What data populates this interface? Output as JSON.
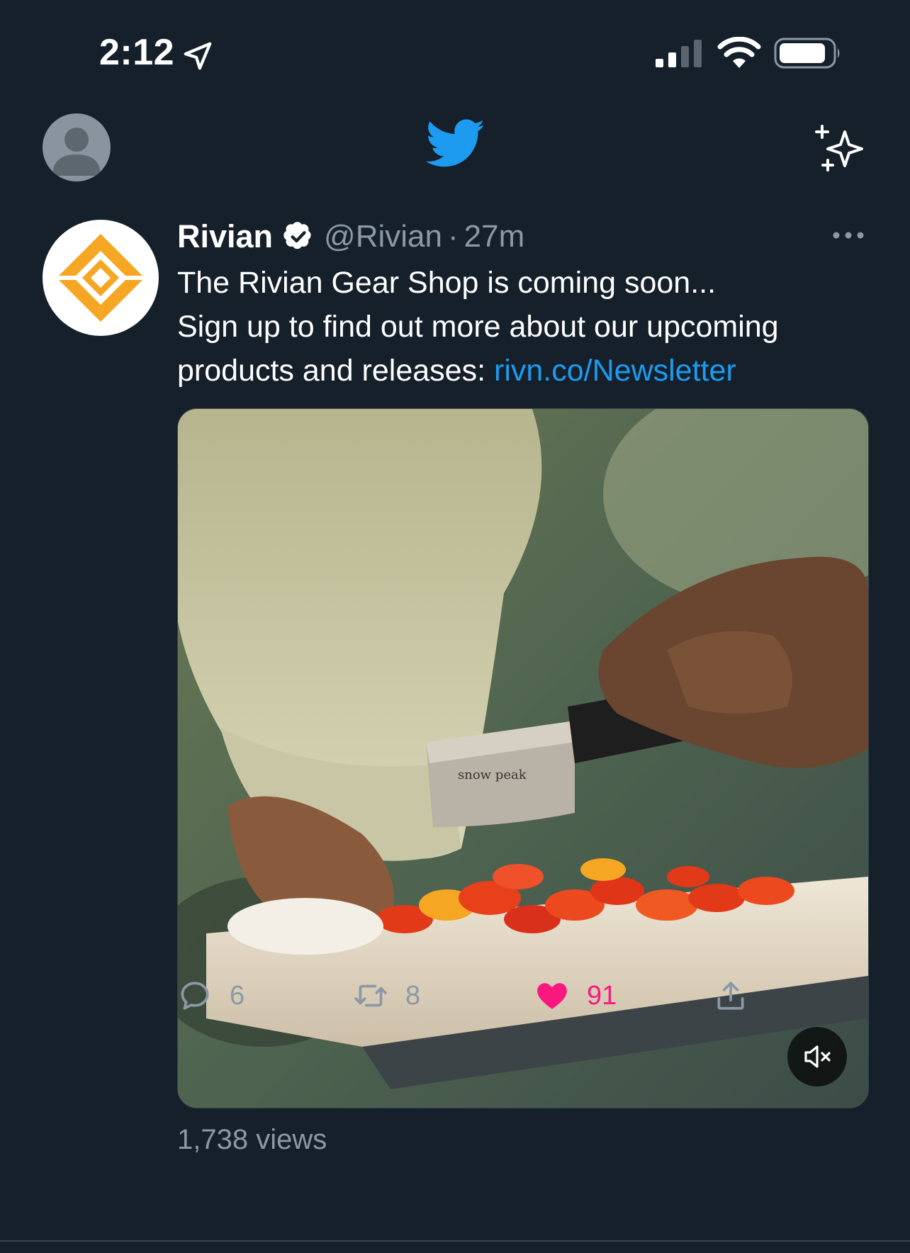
{
  "status_bar": {
    "time": "2:12",
    "icons": [
      "location-arrow-icon",
      "signal-icon",
      "wifi-icon",
      "battery-icon"
    ]
  },
  "top_nav": {
    "icons": [
      "profile-avatar",
      "twitter-logo-icon",
      "sparkle-icon"
    ]
  },
  "tweet": {
    "author_name": "Rivian",
    "verified": true,
    "handle": "@Rivian",
    "separator": "·",
    "time": "27m",
    "text_lines": [
      "The Rivian Gear Shop is coming soon...",
      "Sign up to find out more about our upcoming",
      "products and releases: "
    ],
    "link": "rivn.co/Newsletter",
    "media_brand_text": "snow peak",
    "views": "1,738 views",
    "replies": "6",
    "retweets": "8",
    "likes": "91"
  },
  "colors": {
    "background": "#15202b",
    "secondary_text": "#8b98a5",
    "link": "#1d9bf0",
    "like": "#f91880",
    "brand_gold": "#f5a623"
  }
}
